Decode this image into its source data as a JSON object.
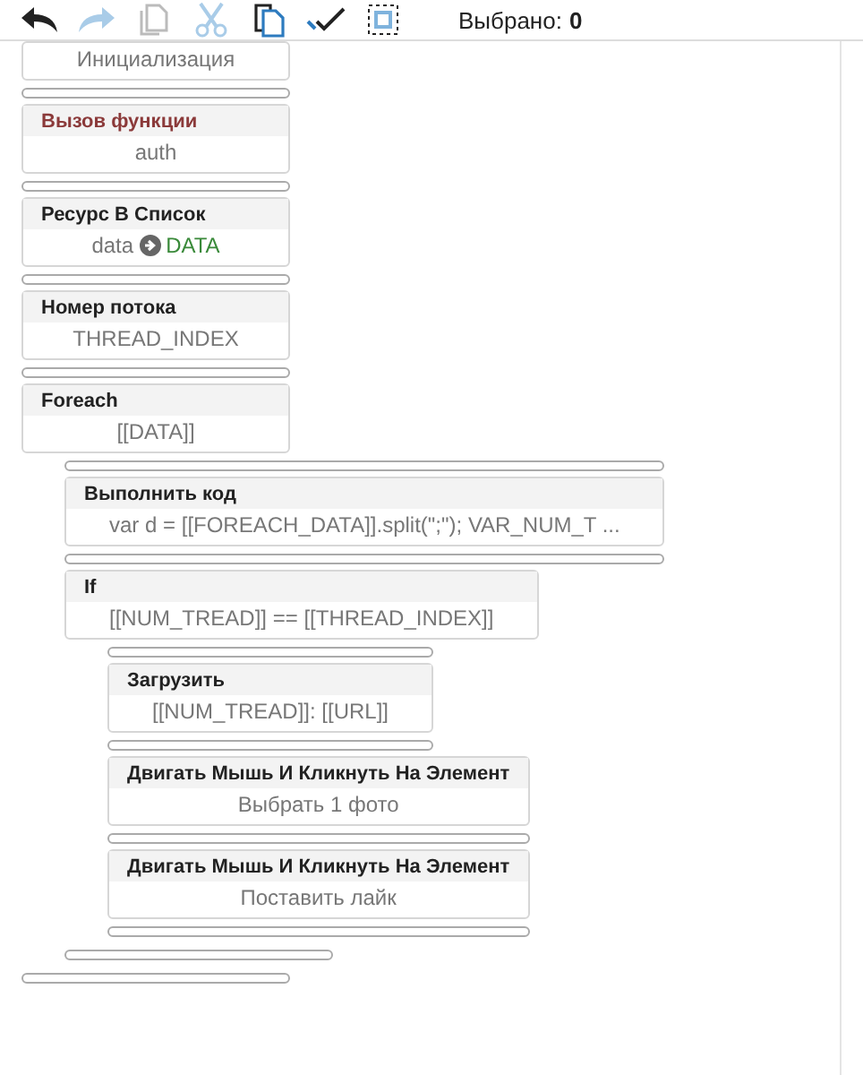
{
  "toolbar": {
    "buttons": [
      {
        "kind": "undo",
        "disabled": false
      },
      {
        "kind": "redo",
        "disabled": true
      },
      {
        "kind": "copy",
        "disabled": true
      },
      {
        "kind": "cut",
        "disabled": true
      },
      {
        "kind": "paste",
        "disabled": false
      },
      {
        "kind": "check",
        "disabled": false
      },
      {
        "kind": "select",
        "disabled": false
      }
    ],
    "selected_label": "Выбрано:",
    "selected_count": "0"
  },
  "blocks": [
    {
      "kind": "text",
      "body": "Инициализация"
    },
    {
      "kind": "text",
      "title": "Вызов функции",
      "color": "#8b3a3a",
      "body": "auth"
    },
    {
      "kind": "assign",
      "title": "Ресурс В Список",
      "from": "data",
      "to": "DATA"
    },
    {
      "kind": "text",
      "title": "Номер потока",
      "body": "THREAD_INDEX"
    },
    {
      "kind": "text",
      "title": "Foreach",
      "body": "[[DATA]]",
      "children": [
        {
          "kind": "text",
          "title": "Выполнить код",
          "body": "var d = [[FOREACH_DATA]].split(\";\"); VAR_NUM_T ..."
        },
        {
          "kind": "text",
          "title": "If",
          "body": "[[NUM_TREAD]] == [[THREAD_INDEX]]",
          "children": [
            {
              "kind": "text",
              "title": "Загрузить",
              "body": "[[NUM_TREAD]]: [[URL]]"
            },
            {
              "kind": "text",
              "title": "Двигать Мышь И Кликнуть На Элемент",
              "body": "Выбрать 1 фото"
            },
            {
              "kind": "text",
              "title": "Двигать Мышь И Кликнуть На Элемент",
              "body": "Поставить лайк"
            }
          ]
        }
      ]
    }
  ]
}
